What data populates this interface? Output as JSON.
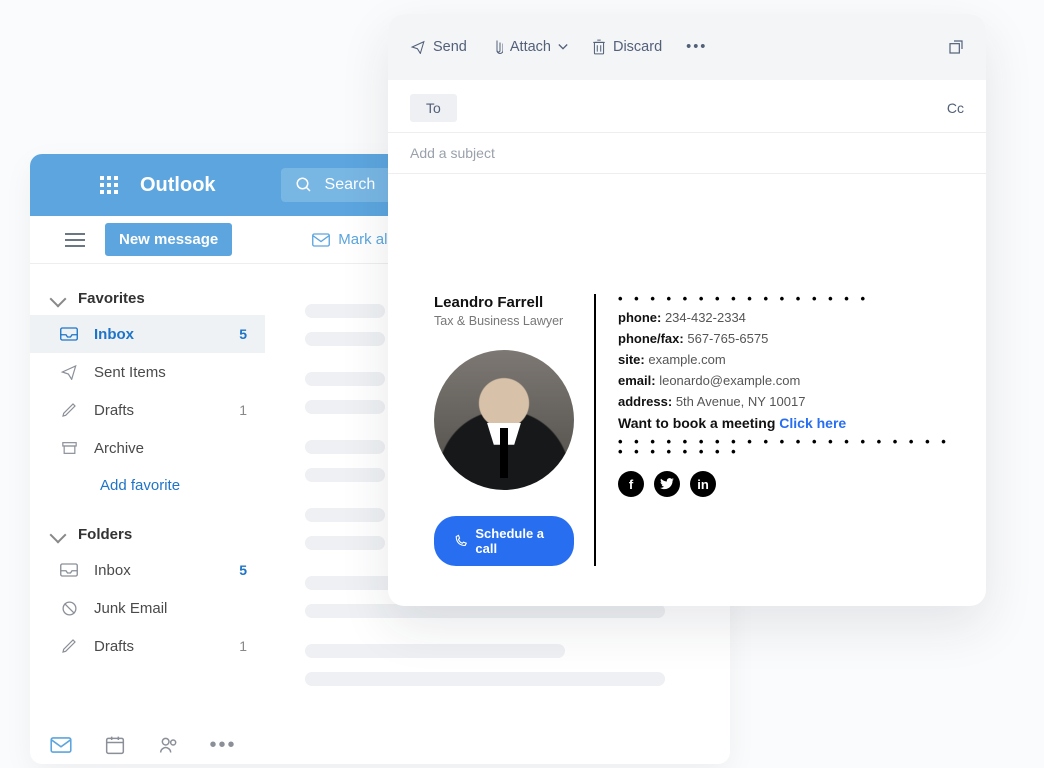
{
  "outlook": {
    "title": "Outlook",
    "search_placeholder": "Search",
    "new_message": "New message",
    "mark_all": "Mark all as re",
    "favorites_header": "Favorites",
    "folders_header": "Folders",
    "add_favorite": "Add favorite",
    "fav_items": [
      {
        "label": "Inbox",
        "count": "5",
        "selected": true
      },
      {
        "label": "Sent Items",
        "count": ""
      },
      {
        "label": "Drafts",
        "count": "1"
      },
      {
        "label": "Archive",
        "count": ""
      }
    ],
    "folder_items": [
      {
        "label": "Inbox",
        "count": "5",
        "blue": true
      },
      {
        "label": "Junk Email",
        "count": ""
      },
      {
        "label": "Drafts",
        "count": "1"
      }
    ]
  },
  "compose": {
    "send": "Send",
    "attach": "Attach",
    "discard": "Discard",
    "to": "To",
    "cc": "Cc",
    "subject_placeholder": "Add a subject"
  },
  "signature": {
    "name": "Leandro Farrell",
    "role": "Tax & Business Lawyer",
    "schedule": "Schedule a call",
    "lines": {
      "phone_label": "phone:",
      "phone": "234-432-2334",
      "fax_label": "phone/fax:",
      "fax": "567-765-6575",
      "site_label": "site:",
      "site": "example.com",
      "email_label": "email:",
      "email": "leonardo@example.com",
      "address_label": "address:",
      "address": "5th Avenue, NY 10017"
    },
    "meeting_text": "Want to book a meeting",
    "meeting_link": "Click here",
    "dots_short": "• • • • • • • • • • • • • • • •",
    "dots_long": "• • • • • • • • • • • • • • • • • • • • • • • • • • • • •"
  }
}
